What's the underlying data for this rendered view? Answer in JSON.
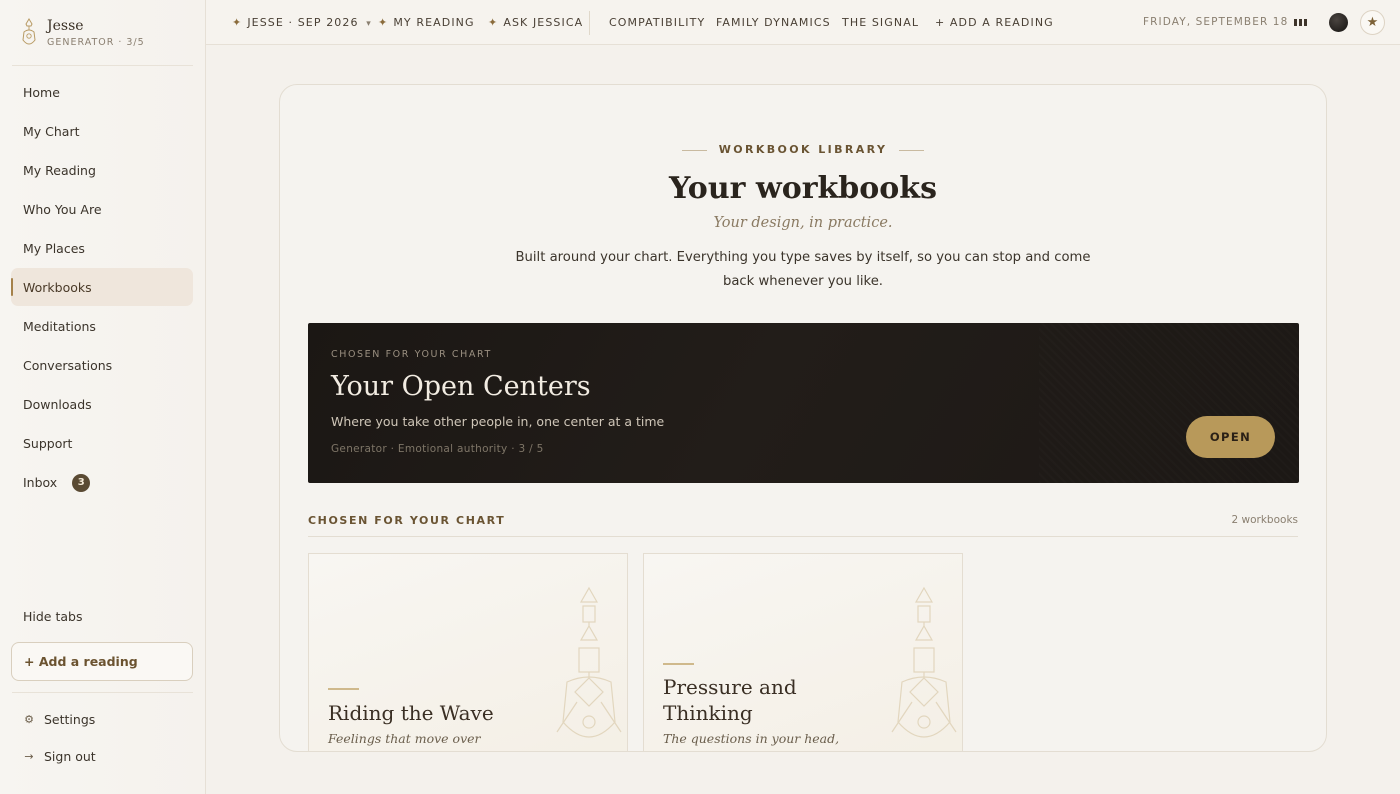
{
  "brand": {
    "name": "Jesse",
    "subtitle": "GENERATOR · 3/5"
  },
  "sidebar": {
    "items": [
      {
        "label": "Home"
      },
      {
        "label": "My Chart"
      },
      {
        "label": "My Reading"
      },
      {
        "label": "Who You Are"
      },
      {
        "label": "My Places"
      },
      {
        "label": "Workbooks",
        "active": true
      },
      {
        "label": "Meditations"
      },
      {
        "label": "Conversations"
      },
      {
        "label": "Downloads"
      },
      {
        "label": "Support"
      },
      {
        "label": "Inbox",
        "badge": "3"
      }
    ],
    "hide_tabs": "Hide tabs",
    "add_reading": "+ Add a reading",
    "settings": "Settings",
    "sign_out": "Sign out"
  },
  "topbar": {
    "profile": "JESSE · SEP 2026",
    "profile_caret": "▾",
    "my_reading": "MY READING",
    "ask": "ASK JESSICA",
    "compat": "COMPATIBILITY",
    "family": "FAMILY DYNAMICS",
    "signal": "THE SIGNAL",
    "add": "+ ADD A READING",
    "date": "FRIDAY, SEPTEMBER 18",
    "star_glyph": "✦"
  },
  "library": {
    "kicker": "WORKBOOK LIBRARY",
    "title": "Your workbooks",
    "subtitle": "Your design, in practice.",
    "intro": "Built around your chart. Everything you type saves by itself, so you can stop and come back whenever you like."
  },
  "featured": {
    "kicker": "CHOSEN FOR YOUR CHART",
    "title": "Your Open Centers",
    "description": "Where you take other people in, one center at a time",
    "meta": "Generator · Emotional authority · 3 / 5",
    "button": "OPEN"
  },
  "section": {
    "heading": "CHOSEN FOR YOUR CHART",
    "count": "2 workbooks"
  },
  "cards": [
    {
      "title": "Riding the Wave",
      "desc": "Feelings that move over time, and"
    },
    {
      "title": "Pressure and Thinking",
      "desc": "The questions in your head, and"
    }
  ],
  "colors": {
    "accent": "#b8995a",
    "dark": "#1c1815",
    "background": "#f4f1ec"
  }
}
